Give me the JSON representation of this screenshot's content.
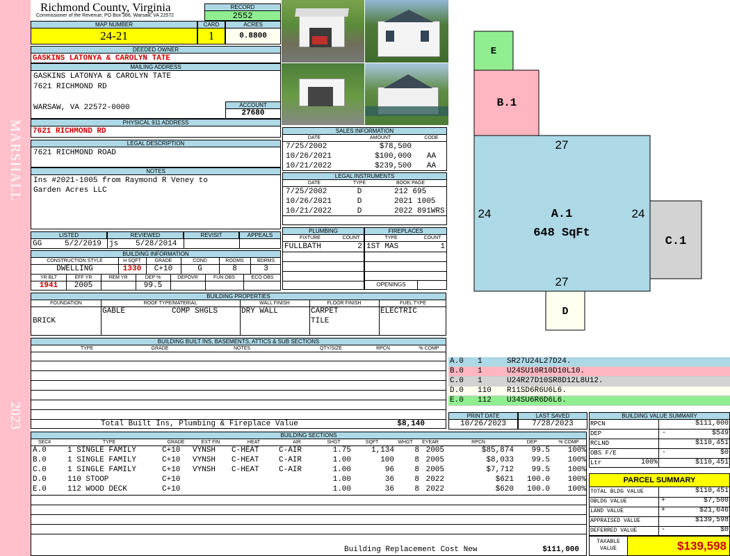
{
  "sidebar": {
    "district": "MARSHALL",
    "year": "2023"
  },
  "county": {
    "title": "Richmond County, Virginia",
    "subtitle": "Commissioner of the Revenue, PO Box 366, Warsaw, VA 22572"
  },
  "record": {
    "label": "RECORD",
    "value": "2552"
  },
  "map": {
    "label": "MAP NUMBER",
    "value": "24-21"
  },
  "card": {
    "label": "CARD",
    "value": "1"
  },
  "acres": {
    "label": "ACRES",
    "value": "0.8800"
  },
  "owner": {
    "label": "DEEDED OWNER",
    "value": "GASKINS LATONYA & CAROLYN TATE"
  },
  "mailing": {
    "label": "MAILING ADDRESS",
    "line1": "GASKINS LATONYA & CAROLYN TATE",
    "line2": "7621 RICHMOND RD",
    "line3": "WARSAW, VA 22572-0000"
  },
  "account": {
    "label": "ACCOUNT",
    "value": "27680"
  },
  "physical": {
    "label": "PHYSICAL 911 ADDRESS",
    "value": "7621 RICHMOND RD"
  },
  "legal_desc": {
    "label": "LEGAL DESCRIPTION",
    "value": "7621 RICHMOND ROAD"
  },
  "notes": {
    "label": "NOTES",
    "line1": "Ins #2021-1005 from Raymond R Veney to",
    "line2": "Garden Acres LLC"
  },
  "listed": {
    "listed_label": "LISTED",
    "reviewed_label": "REVIEWED",
    "revisit_label": "REVISIT",
    "appeals_label": "APPEALS",
    "listed_by": "GG",
    "listed_date": "5/2/2019",
    "reviewed_by": "js",
    "reviewed_date": "5/28/2014"
  },
  "building_info": {
    "label": "BUILDING INFORMATION",
    "h": {
      "construction": "CONSTRUCTION STYLE",
      "hsqft": "H SQFT",
      "grade": "GRADE",
      "cond": "COND",
      "rooms": "ROOMS",
      "bdrms": "BDRMS",
      "yrblt": "YR BLT",
      "effyr": "EFF YR",
      "remyr": "REM YR",
      "dep": "DEP %",
      "depovr": "DEPOVR",
      "funobs": "FUN OBS",
      "ecoobs": "ECO OBS"
    },
    "construction": "DWELLING",
    "hsqft": "1330",
    "grade": "C+10",
    "cond": "G",
    "rooms": "8",
    "bdrms": "3",
    "yrblt": "1941",
    "effyr": "2005",
    "dep": "99.5"
  },
  "sales": {
    "label": "SALES INFORMATION",
    "h_date": "DATE",
    "h_amount": "AMOUNT",
    "h_code": "CODE",
    "rows": [
      {
        "date": "7/25/2002",
        "amount": "$78,500",
        "code": ""
      },
      {
        "date": "10/26/2021",
        "amount": "$100,000",
        "code": "AA"
      },
      {
        "date": "10/21/2022",
        "amount": "$239,500",
        "code": "AA"
      }
    ]
  },
  "legal_inst": {
    "label": "LEGAL INSTRUMENTS",
    "h_date": "DATE",
    "h_type": "TYPE",
    "h_book": "BOOK PAGE",
    "rows": [
      {
        "date": "7/25/2002",
        "type": "D",
        "book": "212 695"
      },
      {
        "date": "10/26/2021",
        "type": "D",
        "book": "2021 1005"
      },
      {
        "date": "10/21/2022",
        "type": "D",
        "book": "2022 891WRS"
      }
    ]
  },
  "plumbing": {
    "label": "PLUMBING",
    "h_fixture": "FIXTURE",
    "h_count": "COUNT",
    "fixture": "FULLBATH",
    "count": "2"
  },
  "fireplaces": {
    "label": "FIREPLACES",
    "h_type": "TYPE",
    "h_count": "COUNT",
    "type": "1ST MAS",
    "count": "1",
    "openings_label": "OPENINGS"
  },
  "properties": {
    "label": "BUILDING PROPERTIES",
    "h_found": "FOUNDATION",
    "h_roof": "ROOF TYPE/MATERIAL",
    "h_wall": "WALL FINISH",
    "h_floor": "FLOOR FINISH",
    "h_fuel": "FUEL TYPE",
    "foundation": "BRICK",
    "roof_type": "GABLE",
    "roof_mat": "COMP SHGLS",
    "wall": "DRY WALL",
    "floor1": "CARPET",
    "floor2": "TILE",
    "fuel": "ELECTRIC"
  },
  "builtins": {
    "label": "BUILDING BUILT INS, BASEMENTS, ATTICS & SUB SECTIONS",
    "h_type": "TYPE",
    "h_grade": "GRADE",
    "h_notes": "NOTES",
    "h_qty": "QTY/SIZE",
    "h_rpcn": "RPCN",
    "h_comp": "% COMP",
    "total_label": "Total Built Ins, Plumbing & Fireplace Value",
    "total_value": "$8,140"
  },
  "dates": {
    "print_label": "PRINT DATE",
    "print_value": "10/26/2023",
    "saved_label": "LAST SAVED",
    "saved_value": "7/28/2023"
  },
  "sections": {
    "label": "BUILDING SECTIONS",
    "h": [
      "SEC#",
      "TYPE",
      "GRADE",
      "EXT FIN",
      "HEAT",
      "AIR",
      "SHGT",
      "SQFT",
      "WHGT",
      "EYEAR",
      "RPCN",
      "DEP",
      "% COMP"
    ],
    "rows": [
      [
        "A.0",
        "1 SINGLE FAMILY",
        "C+10",
        "VYNSH",
        "C-HEAT",
        "C-AIR",
        "1.75",
        "1,134",
        "8",
        "2005",
        "$85,874",
        "99.5",
        "100%"
      ],
      [
        "B.0",
        "1 SINGLE FAMILY",
        "C+10",
        "VYNSH",
        "C-HEAT",
        "C-AIR",
        "1.00",
        "100",
        "8",
        "2005",
        "$8,033",
        "99.5",
        "100%"
      ],
      [
        "C.0",
        "1 SINGLE FAMILY",
        "C+10",
        "VYNSH",
        "C-HEAT",
        "C-AIR",
        "1.00",
        "96",
        "8",
        "2005",
        "$7,712",
        "99.5",
        "100%"
      ],
      [
        "D.0",
        "110 STOOP",
        "C+10",
        "",
        "",
        "",
        "1.00",
        "36",
        "8",
        "2022",
        "$621",
        "100.0",
        "100%"
      ],
      [
        "E.0",
        "112 WOOD DECK",
        "C+10",
        "",
        "",
        "",
        "1.00",
        "36",
        "8",
        "2022",
        "$620",
        "100.0",
        "100%"
      ]
    ],
    "replacement_label": "Building Replacement Cost New",
    "replacement_value": "$111,000"
  },
  "sketch": {
    "labels": {
      "e": "E",
      "b1": "B.1",
      "a1": "A.1",
      "a1_area": "648 SqFt",
      "c1": "C.1",
      "d": "D",
      "top": "27",
      "bottom": "27",
      "left": "24",
      "right": "24"
    },
    "legend": [
      {
        "code": "A.0",
        "num": "1",
        "vec": "SR27U24L27D24.",
        "color": "#add8e6"
      },
      {
        "code": "B.0",
        "num": "1",
        "vec": "U24SU10R10D10L10.",
        "color": "#ffb6c1"
      },
      {
        "code": "C.0",
        "num": "1",
        "vec": "U24R27D10SR8D12L8U12.",
        "color": "#d3d3d3"
      },
      {
        "code": "D.0",
        "num": "110",
        "vec": "R11SD6R6U6L6.",
        "color": "#fffff0"
      },
      {
        "code": "E.0",
        "num": "112",
        "vec": "U34SU6R6D6L6.",
        "color": "#90ee90"
      }
    ],
    "colors": {
      "a": "#add8e6",
      "b": "#ffb6c1",
      "c": "#d3d3d3",
      "d": "#fffff0",
      "e": "#90ee90"
    }
  },
  "value_summary": {
    "label": "BUILDING VALUE SUMMARY",
    "rpcn_label": "RPCN",
    "rpcn": "$111,000",
    "dep_label": "DEP",
    "dep_sign": "-",
    "dep": "$549",
    "rclnd_label": "RCLND",
    "rclnd": "$110,451",
    "obs_label": "OBS F/E",
    "obs_sign": "-",
    "obs": "$0",
    "ltr_label": "Ltr",
    "ltr_pct": "100%",
    "ltr": "$110,451"
  },
  "parcel": {
    "label": "PARCEL SUMMARY",
    "total_bldg_label": "TOTAL BLDG VALUE",
    "total_bldg": "$110,451",
    "obldg_label": "OBLDG VALUE",
    "obldg_sign": "+",
    "obldg": "$7,500",
    "land_label": "LAND VALUE",
    "land_sign": "+",
    "land": "$21,646",
    "appraised_label": "APPRAISED VALUE",
    "appraised": "$139,598",
    "deferred_label": "DEFERRED VALUE",
    "deferred_sign": "-",
    "deferred": "$0",
    "taxable_label1": "TAXABLE",
    "taxable_label2": "VALUE",
    "taxable": "$139,598"
  }
}
